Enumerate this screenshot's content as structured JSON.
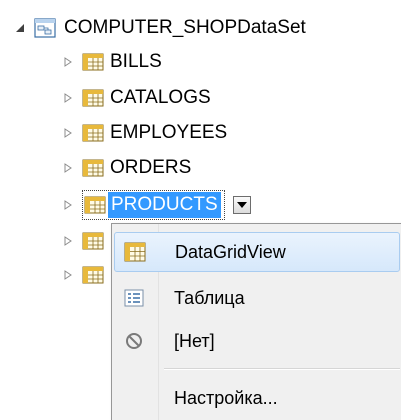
{
  "tree": {
    "root": {
      "label": "COMPUTER_SHOPDataSet",
      "icon": "dataset-icon",
      "expanded": true
    },
    "items": [
      {
        "label": "BILLS",
        "icon": "table-icon"
      },
      {
        "label": "CATALOGS",
        "icon": "table-icon"
      },
      {
        "label": "EMPLOYEES",
        "icon": "table-icon"
      },
      {
        "label": "ORDERS",
        "icon": "table-icon"
      },
      {
        "label": "PRODUCTS",
        "icon": "table-icon",
        "selected": true
      },
      {
        "label": "",
        "icon": "table-icon"
      },
      {
        "label": "",
        "icon": "table-icon"
      }
    ]
  },
  "menu": {
    "items": [
      {
        "label": "DataGridView",
        "icon": "datagridview-icon",
        "highlighted": true
      },
      {
        "label": "Таблица",
        "icon": "details-icon"
      },
      {
        "label": "[Нет]",
        "icon": "none-icon"
      },
      {
        "label": "Настройка...",
        "icon": ""
      }
    ]
  },
  "colors": {
    "selection": "#3399ff",
    "menu_background": "#f0f0f0",
    "menu_highlight": "#d6e8fb",
    "menu_highlight_border": "#a9ccf0"
  }
}
